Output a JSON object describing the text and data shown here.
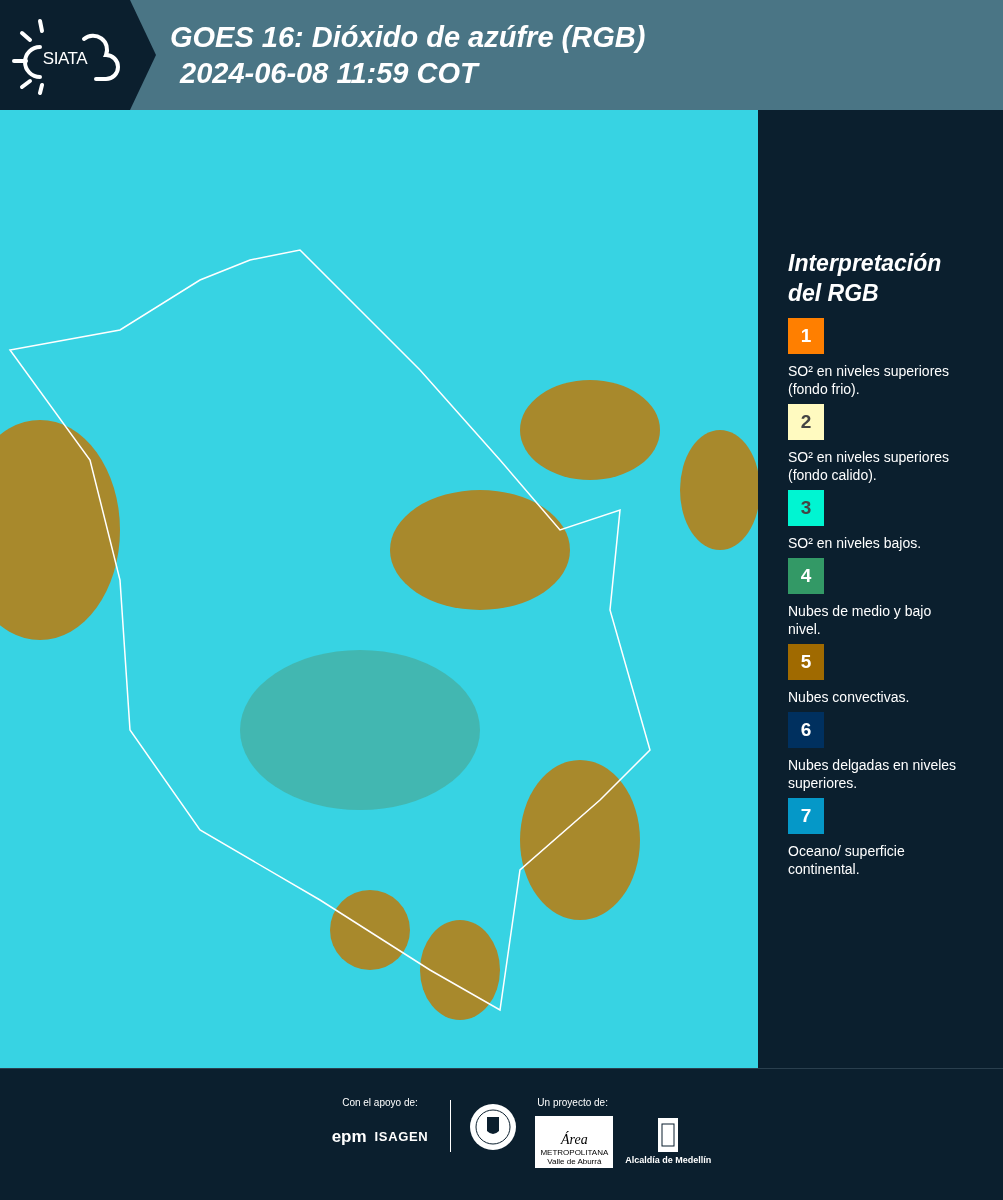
{
  "header": {
    "logo_text": "SIATA",
    "title": "GOES 16: Dióxido de azúfre (RGB)",
    "timestamp": "2024-06-08 11:59 COT"
  },
  "legend": {
    "title_lines": [
      "Interpretación",
      "del RGB"
    ],
    "items": [
      {
        "number": "1",
        "color": "#ff7f00",
        "label": "SO² en niveles superiores (fondo frio)."
      },
      {
        "number": "2",
        "color": "#fffac0",
        "label": "SO² en niveles superiores (fondo calido)."
      },
      {
        "number": "3",
        "color": "#00f5d2",
        "label": "SO² en niveles bajos."
      },
      {
        "number": "4",
        "color": "#339966",
        "label": "Nubes de medio y bajo nivel."
      },
      {
        "number": "5",
        "color": "#a06a00",
        "label": "Nubes convectivas."
      },
      {
        "number": "6",
        "color": "#00305f",
        "label": "Nubes delgadas en niveles superiores."
      },
      {
        "number": "7",
        "color": "#0598c8",
        "label": "Oceano/ superficie continental."
      }
    ]
  },
  "footer": {
    "support_label": "Con el apoyo de:",
    "support_logos": [
      "epm",
      "ISAGEN"
    ],
    "project_label": "Un proyecto de:",
    "area_logo": {
      "name": "Área",
      "lines": [
        "METROPOLITANA",
        "Valle de Aburrá"
      ]
    },
    "alcaldia_logo": "Alcaldía de Medellín"
  }
}
